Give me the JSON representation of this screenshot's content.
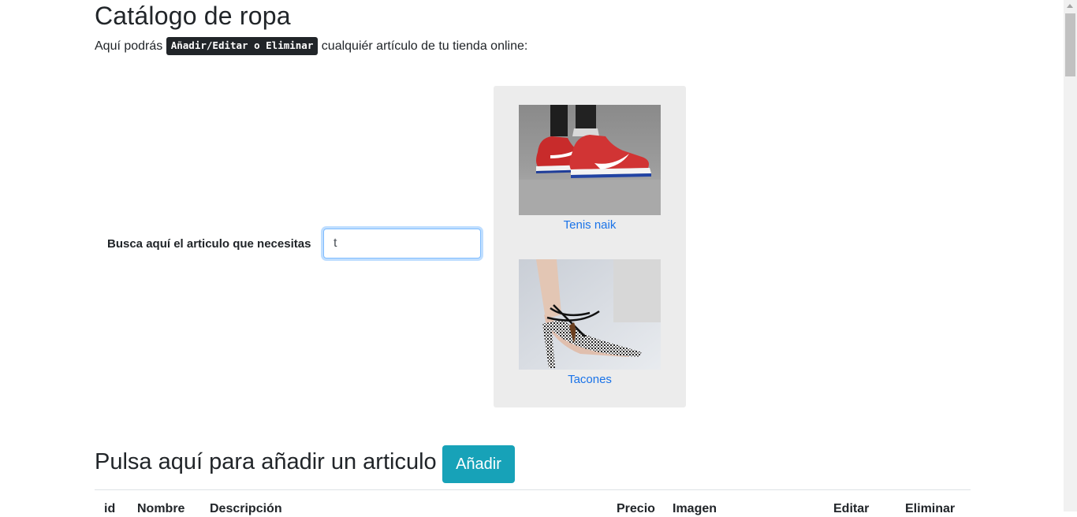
{
  "header": {
    "title": "Catálogo de ropa",
    "intro_before": "Aquí podrás ",
    "intro_code": "Añadir/Editar o Eliminar",
    "intro_after": " cualquiér artículo de tu tienda online:"
  },
  "search": {
    "label": "Busca aquí el articulo que necesitas",
    "value": "t"
  },
  "results": [
    {
      "name": "Tenis naik",
      "image": "red-sneakers-photo"
    },
    {
      "name": "Tacones",
      "image": "gingham-heels-photo"
    }
  ],
  "add_section": {
    "title": "Pulsa aquí para añadir un articulo",
    "button_label": "Añadir"
  },
  "table": {
    "headers": [
      "id",
      "Nombre",
      "Descripción",
      "Precio",
      "Imagen",
      "Editar",
      "Eliminar"
    ]
  },
  "colors": {
    "accent_button": "#17a2b8",
    "link": "#1a73e8",
    "results_panel_bg": "#ececec"
  }
}
